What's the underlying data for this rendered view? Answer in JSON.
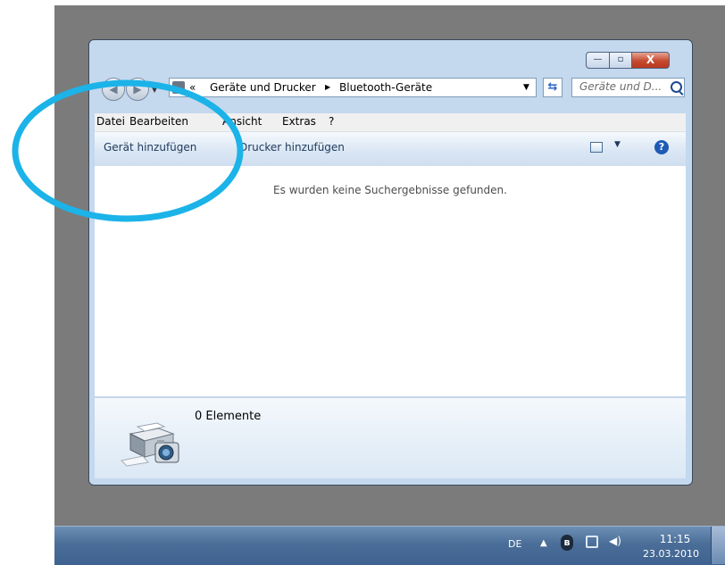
{
  "address_bar": {
    "overflow": "«",
    "crumbs": [
      "Geräte und Drucker",
      "Bluetooth-Geräte"
    ],
    "crumb_arrow": "▶",
    "dropdown": "▼"
  },
  "search": {
    "placeholder": "Geräte und D..."
  },
  "menu": [
    "Datei",
    "Bearbeiten",
    "Ansicht",
    "Extras",
    "?"
  ],
  "commands": [
    "Gerät hinzufügen",
    "Drucker hinzufügen"
  ],
  "content": {
    "empty_message": "Es wurden keine Suchergebnisse gefunden."
  },
  "details": {
    "count": "0 Elemente"
  },
  "window_controls": {
    "minimize": "—",
    "maximize": "▫",
    "close": "X"
  },
  "taskbar": {
    "language": "DE",
    "tray_arrow": "▲",
    "time": "11:15",
    "date": "23.03.2010"
  },
  "colors": {
    "annotation_circle": "#1bb3e8",
    "accent": "#1f5bb5"
  }
}
